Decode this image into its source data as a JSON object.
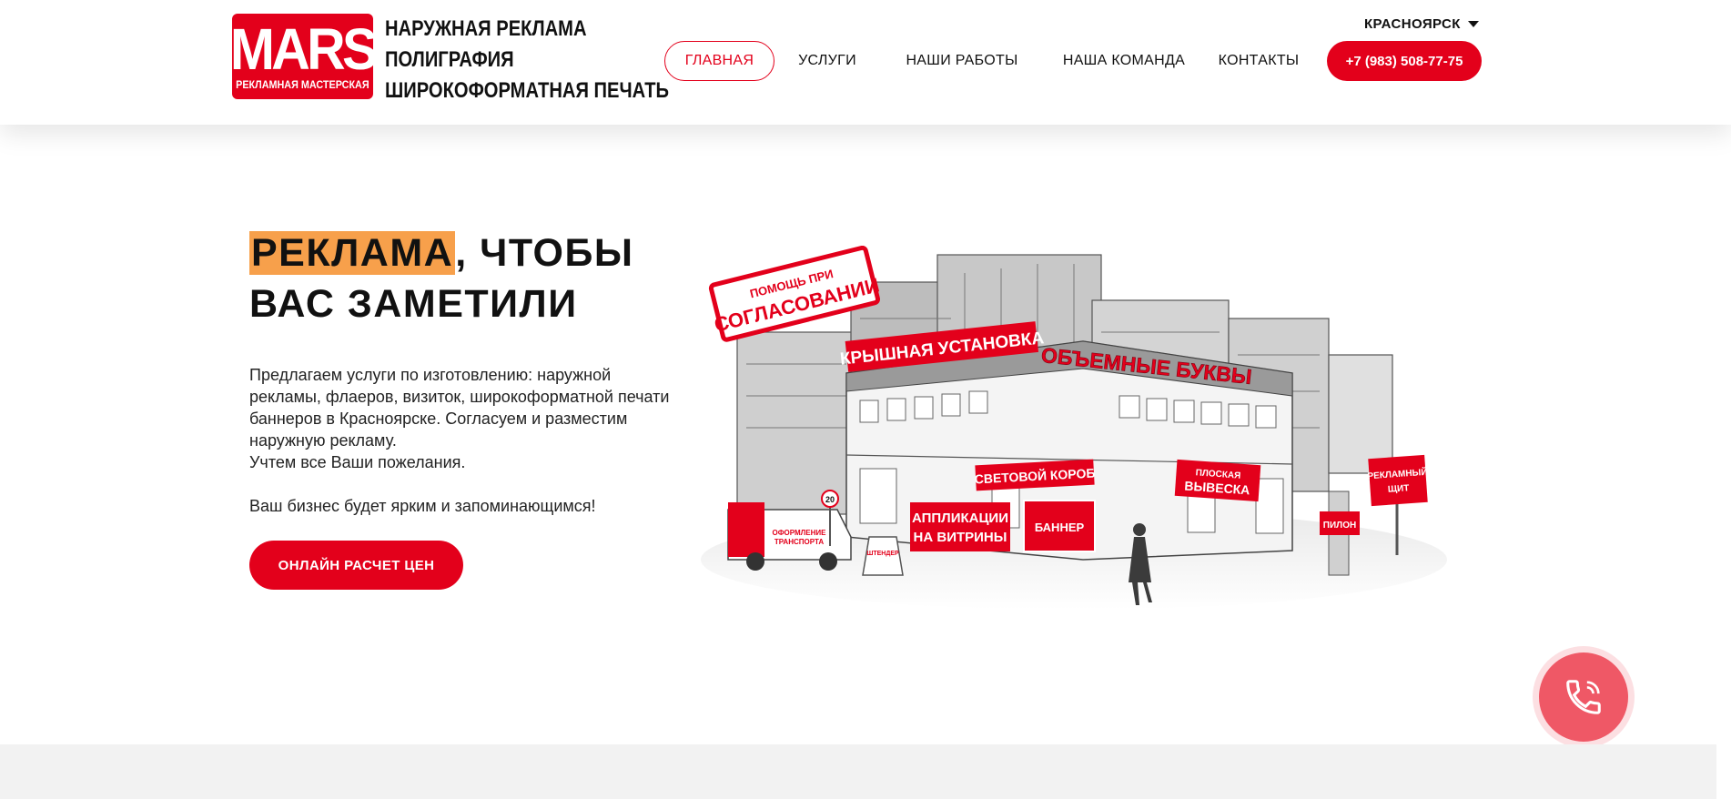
{
  "brand": {
    "logo_word": "MARS",
    "logo_sub": "РЕКЛАМНАЯ МАСТЕРСКАЯ",
    "tagline": [
      "НАРУЖНАЯ РЕКЛАМА",
      "ПОЛИГРАФИЯ",
      "ШИРОКОФОРМАТНАЯ ПЕЧАТЬ"
    ],
    "color": "#e3001b"
  },
  "nav": {
    "items": [
      {
        "label": "ГЛАВНАЯ",
        "active": true
      },
      {
        "label": "УСЛУГИ",
        "active": false
      },
      {
        "label": "НАШИ РАБОТЫ",
        "active": false
      },
      {
        "label": "НАША КОМАНДА",
        "active": false
      },
      {
        "label": "КОНТАКТЫ",
        "active": false
      }
    ],
    "phone": "+7 (983) 508-77-75",
    "city": "КРАСНОЯРСК"
  },
  "hero": {
    "title_highlight": "РЕКЛАМА",
    "title_rest": ", ЧТОБЫ",
    "title_line2": "ВАС ЗАМЕТИЛИ",
    "highlight_color": "#f7a04b",
    "description": "Предлагаем услуги по изготовлению: наружной рекламы, флаеров, визиток, широкоформатной печати баннеров в Красноярске. Согласуем и разместим наружную рекламу.",
    "description2": "Учтем все Ваши пожелания.",
    "description3": "Ваш бизнес будет ярким и запоминающимся!",
    "cta": "ОНЛАЙН РАСЧЕТ ЦЕН"
  },
  "illustration": {
    "stamp_small": "ПОМОЩЬ ПРИ",
    "stamp_big": "СОГЛАСОВАНИИ",
    "roof": "КРЫШНАЯ УСТАНОВКА",
    "letters": "ОБЪЕМНЫЕ БУКВЫ",
    "lightbox": "СВЕТОВОЙ КОРОБ",
    "flat_sign_1": "ПЛОСКАЯ",
    "flat_sign_2": "ВЫВЕСКА",
    "appl_1": "АППЛИКАЦИИ",
    "appl_2": "НА ВИТРИНЫ",
    "banner": "БАННЕР",
    "pylon": "ПИЛОН",
    "billboard_1": "РЕКЛАМНЫЙ",
    "billboard_2": "ЩИТ",
    "transport_1": "ОФОРМЛЕНИЕ",
    "transport_2": "ТРАНСПОРТА",
    "stopper": "ШТЕНДЕР",
    "speed_sign": "20",
    "accent_color": "#e3001b"
  },
  "call_widget": {
    "icon": "phone-icon",
    "color": "#ef5866"
  }
}
